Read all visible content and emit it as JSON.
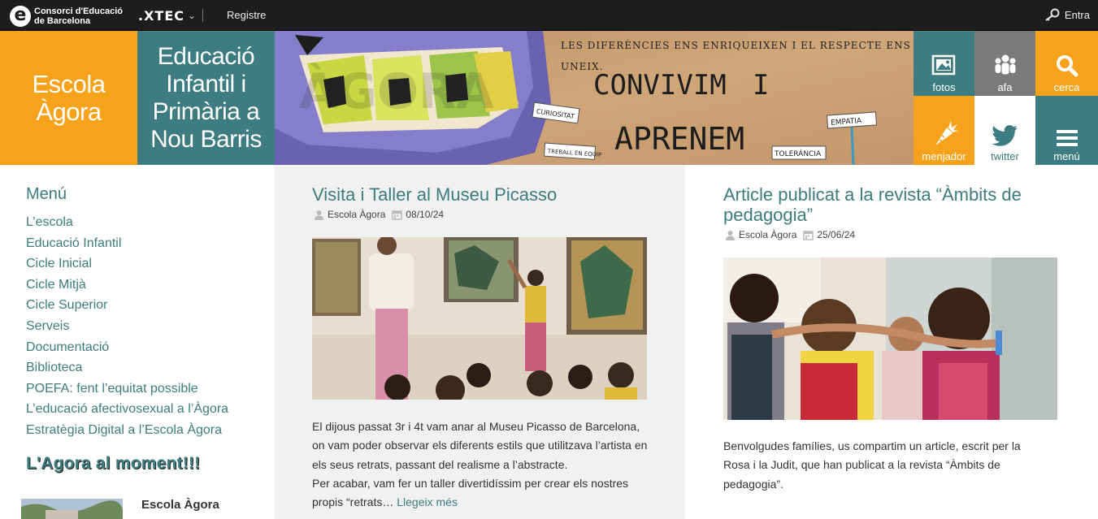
{
  "topbar": {
    "ceb_line1": "Consorci d'Educació",
    "ceb_line2": "de Barcelona",
    "xtec": ".XTEC",
    "register": "Registre",
    "login": "Entra"
  },
  "header": {
    "school_name": "Escola Àgora",
    "school_desc": "Educació Infantil i Primària a Nou Barris",
    "banner": {
      "mural_word": "ÀGORA",
      "strip_line1": "LES DIFERÈNCIES ENS ENRIQUEIXEN I EL RESPECTE ENS",
      "strip_line2": "UNEIX.",
      "word_convivim": "CONVIVIM",
      "word_i": "I",
      "word_aprenem": "APRENEM",
      "tag_empatia": "EMPATIA",
      "tag_tolerancia": "TOLERÀNCIA",
      "tag_left1": "CURIOSITAT",
      "tag_left2": "TREBALL EN EQUIP"
    },
    "tiles": [
      {
        "label": "fotos",
        "color": "#3d7c80"
      },
      {
        "label": "afa",
        "color": "#7a7a7a"
      },
      {
        "label": "cerca",
        "color": "#f7a21b"
      },
      {
        "label": "menjador",
        "color": "#f7a21b"
      },
      {
        "label": "twitter",
        "color": "#ffffff"
      },
      {
        "label": "menú",
        "color": "#3d7c80"
      }
    ]
  },
  "sidebar": {
    "menu_title": "Menú",
    "items": [
      "L’escola",
      "Educació Infantil",
      "Cicle Inicial",
      "Cicle Mitjà",
      "Cicle Superior",
      "Serveis",
      "Documentació",
      "Biblioteca",
      "POEFA: fent l’equitat possible",
      "L’educació afectivosexual a l’Àgora",
      "Estratègia Digital a l’Escola Àgora"
    ],
    "moment_title": "L'Agora al moment!!!",
    "widget_author": "Escola Àgora"
  },
  "posts": [
    {
      "title": "Visita i Taller al Museu Picasso",
      "author": "Escola Àgora",
      "date": "08/10/24",
      "excerpt": "El dijous passat 3r i 4t vam anar al Museu Picasso de Barcelona, on vam poder observar els diferents estils que utilitzava l’artista en els seus retrats, passant del realisme a l’abstracte.",
      "excerpt2": "Per acabar, vam fer un taller divertidíssim per crear els nostres propis “retrats…",
      "readmore": "Llegeix més"
    },
    {
      "title": "Article publicat a la revista “Àmbits de pedagogia”",
      "author": "Escola Àgora",
      "date": "25/06/24",
      "excerpt": "Benvolgudes famílies, us compartim un article, escrit per la Rosa i la Judit, que han publicat a la revista “Àmbits de pedagogia”."
    }
  ],
  "colors": {
    "orange": "#f7a21b",
    "teal": "#3d7c80",
    "grey": "#7a7a7a",
    "topbar": "#1d1d1d"
  }
}
